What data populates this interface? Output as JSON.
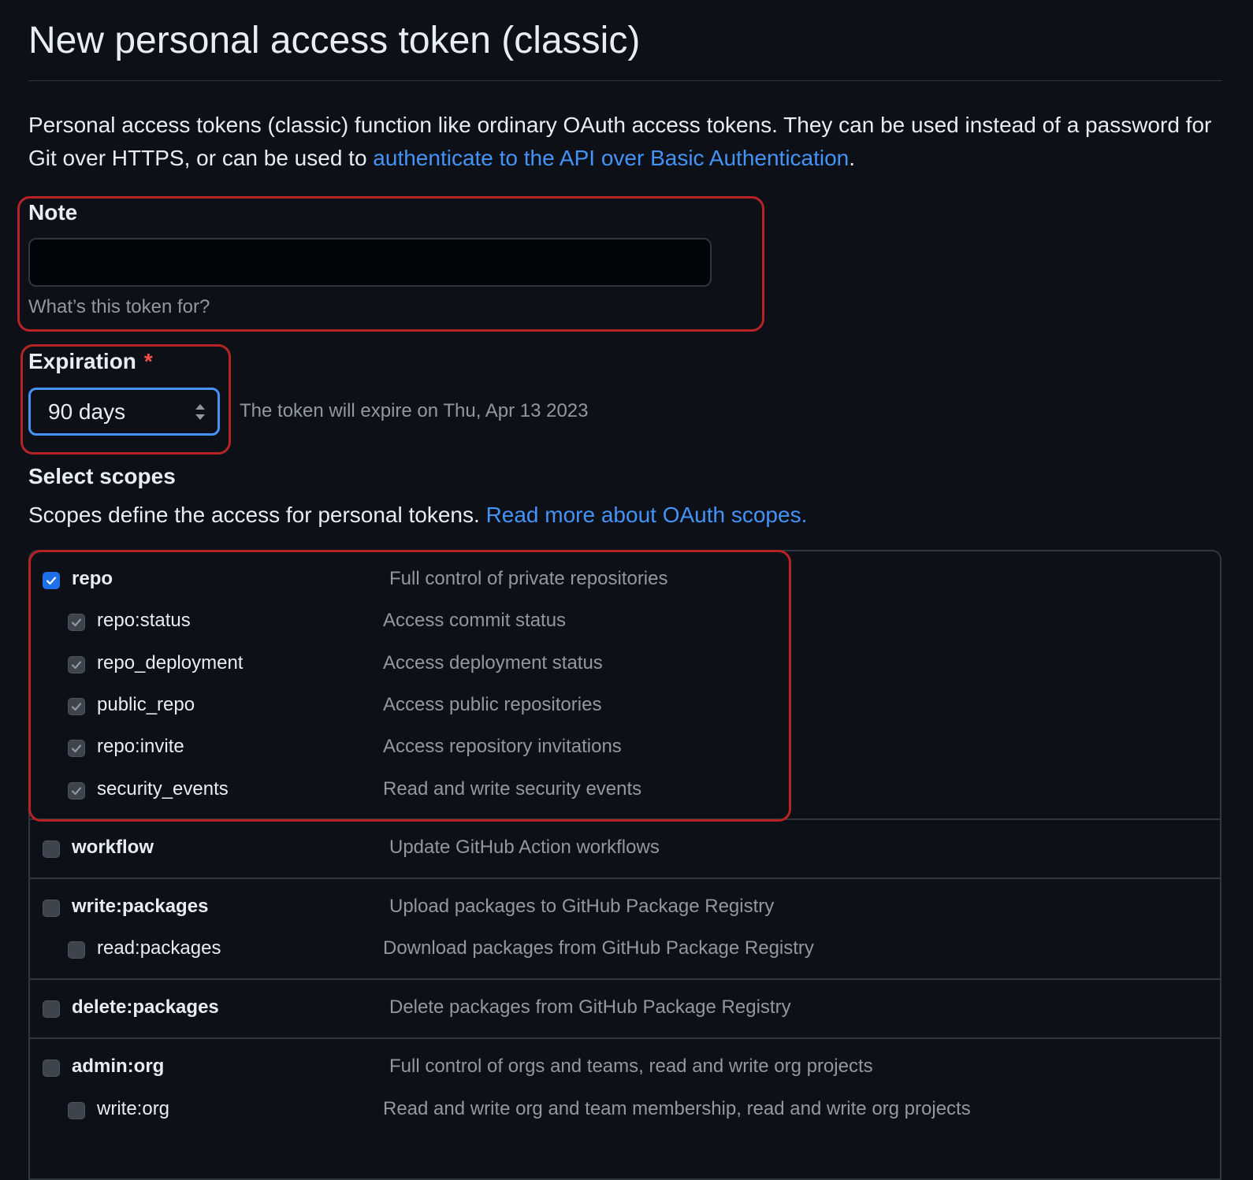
{
  "title": "New personal access token (classic)",
  "intro": {
    "text": "Personal access tokens (classic) function like ordinary OAuth access tokens. They can be used instead of a password for Git over HTTPS, or can be used to ",
    "link": "authenticate to the API over Basic Authentication",
    "end": "."
  },
  "note": {
    "label": "Note",
    "value": "",
    "hint": "What’s this token for?"
  },
  "expiration": {
    "label": "Expiration",
    "required_mark": "*",
    "selected": "90 days",
    "expire_text": "The token will expire on Thu, Apr 13 2023"
  },
  "scopes": {
    "title": "Select scopes",
    "description": "Scopes define the access for personal tokens. ",
    "link": "Read more about OAuth scopes.",
    "items": [
      {
        "name": "repo",
        "desc": "Full control of private repositories",
        "checked": true,
        "level": 0
      },
      {
        "name": "repo:status",
        "desc": "Access commit status",
        "checked": true,
        "level": 1
      },
      {
        "name": "repo_deployment",
        "desc": "Access deployment status",
        "checked": true,
        "level": 1
      },
      {
        "name": "public_repo",
        "desc": "Access public repositories",
        "checked": true,
        "level": 1
      },
      {
        "name": "repo:invite",
        "desc": "Access repository invitations",
        "checked": true,
        "level": 1
      },
      {
        "name": "security_events",
        "desc": "Read and write security events",
        "checked": true,
        "level": 1
      },
      {
        "name": "workflow",
        "desc": "Update GitHub Action workflows",
        "checked": false,
        "level": 0
      },
      {
        "name": "write:packages",
        "desc": "Upload packages to GitHub Package Registry",
        "checked": false,
        "level": 0
      },
      {
        "name": "read:packages",
        "desc": "Download packages from GitHub Package Registry",
        "checked": false,
        "level": 1
      },
      {
        "name": "delete:packages",
        "desc": "Delete packages from GitHub Package Registry",
        "checked": false,
        "level": 0
      },
      {
        "name": "admin:org",
        "desc": "Full control of orgs and teams, read and write org projects",
        "checked": false,
        "level": 0
      },
      {
        "name": "write:org",
        "desc": "Read and write org and team membership, read and write org projects",
        "checked": false,
        "level": 1
      }
    ]
  },
  "colors": {
    "background": "#0d1117",
    "link": "#4493f8",
    "highlight": "#b62324",
    "checkbox_checked": "#1f6feb"
  }
}
